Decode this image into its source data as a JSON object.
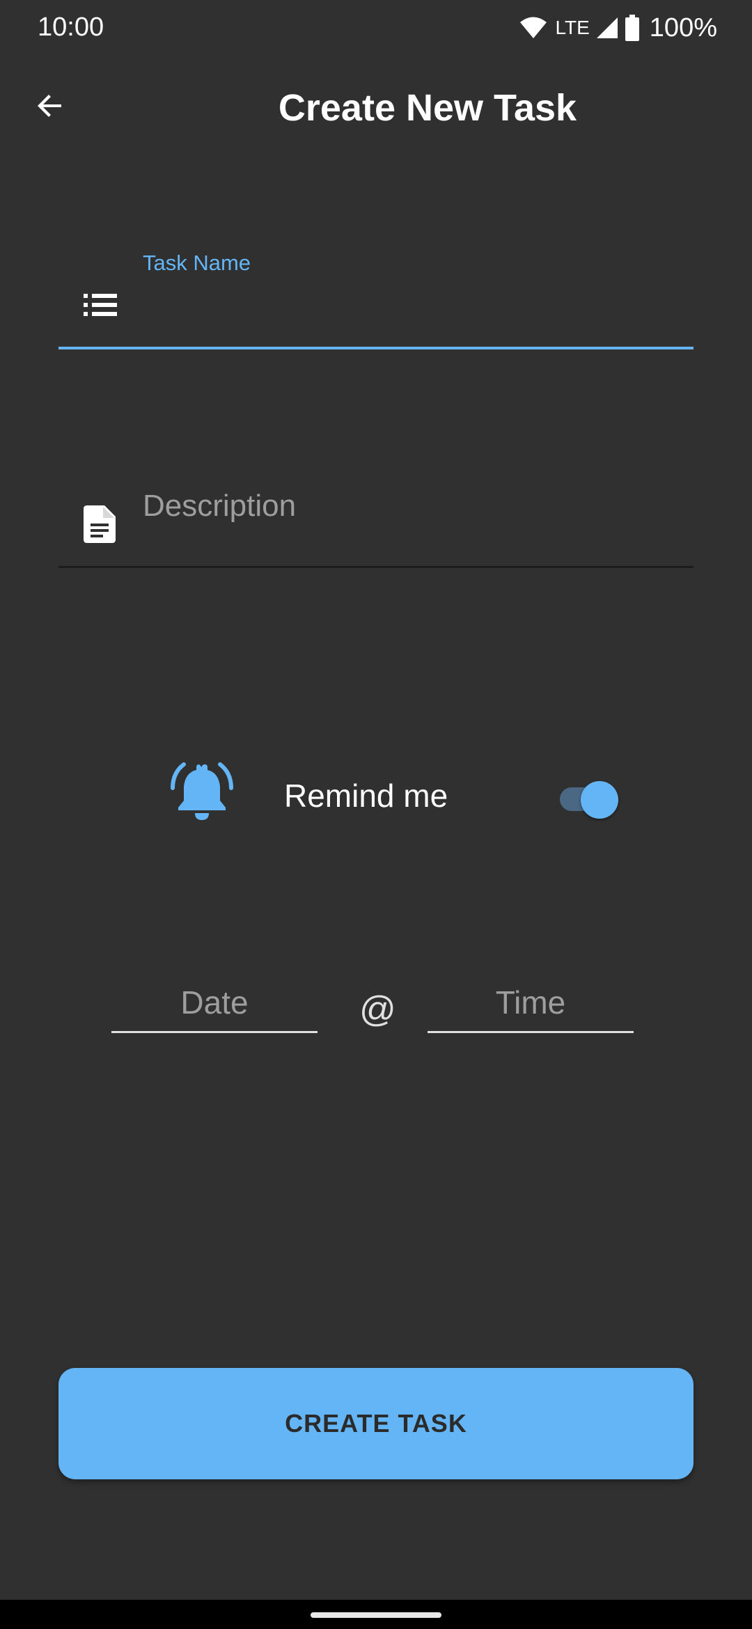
{
  "status_bar": {
    "time": "10:00",
    "network": "LTE",
    "battery": "100%"
  },
  "app_bar": {
    "title": "Create New Task",
    "back_icon": "arrow-back-icon"
  },
  "form": {
    "task_name": {
      "label": "Task Name",
      "value": "",
      "icon": "list-icon"
    },
    "description": {
      "placeholder": "Description",
      "icon": "document-icon"
    },
    "reminder": {
      "label": "Remind me",
      "enabled": true,
      "icon": "alarm-bell-icon"
    },
    "date": {
      "placeholder": "Date"
    },
    "separator": "@",
    "time": {
      "placeholder": "Time"
    }
  },
  "actions": {
    "create_label": "CREATE TASK"
  },
  "colors": {
    "background": "#303030",
    "accent": "#64b5f6",
    "placeholder": "#9e9e9e"
  }
}
